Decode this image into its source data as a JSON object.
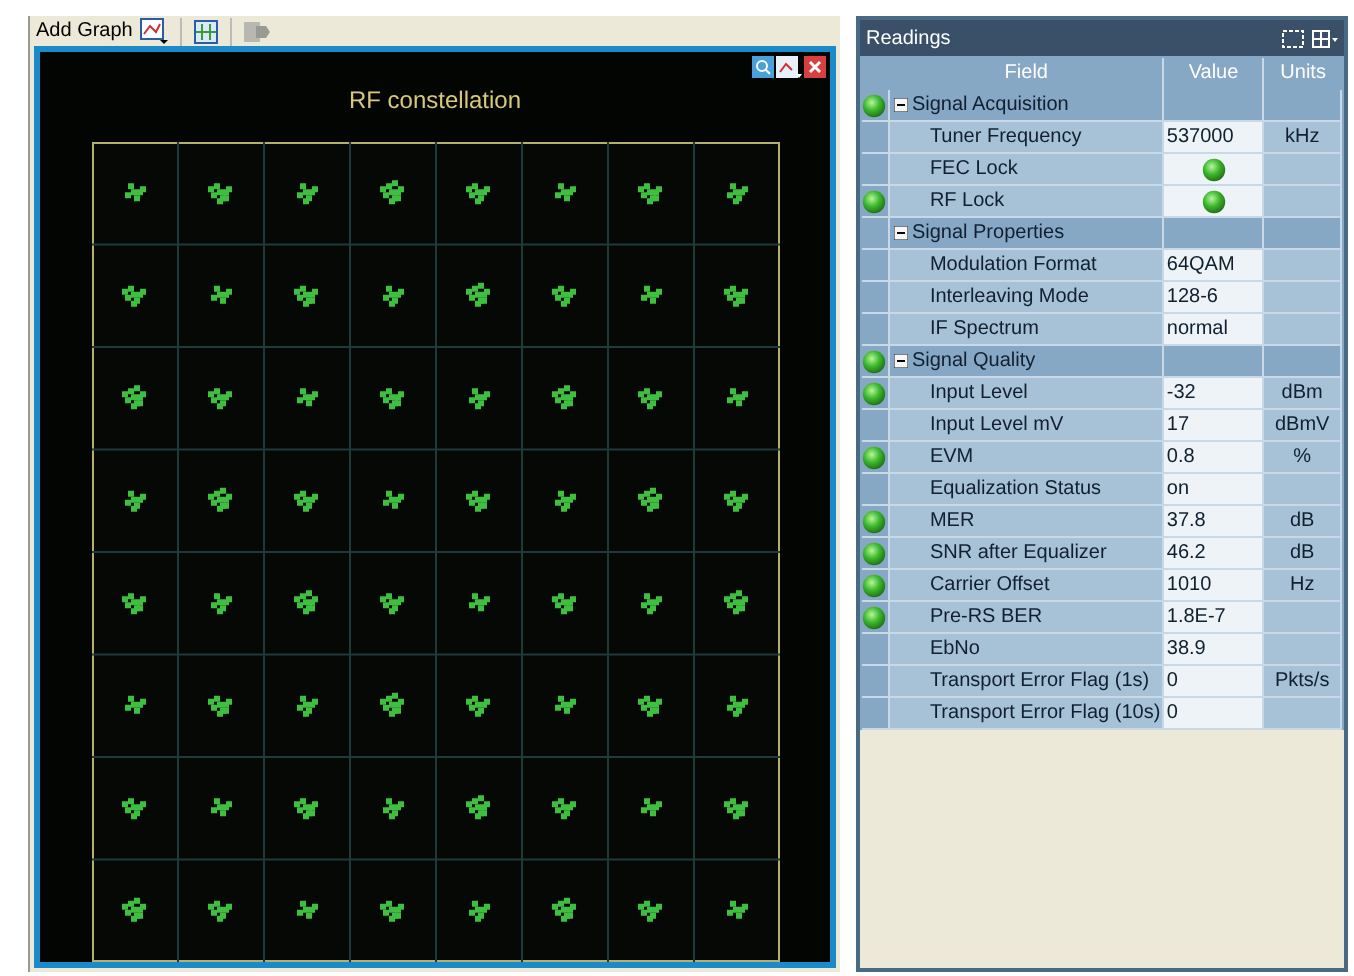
{
  "toolbar": {
    "add_graph": "Add Graph"
  },
  "graph": {
    "title": "RF constellation"
  },
  "readings": {
    "title": "Readings",
    "columns": [
      "Field",
      "Value",
      "Units"
    ],
    "rows": [
      {
        "kind": "group",
        "label": "Signal Acquisition",
        "status": true,
        "expanded": true
      },
      {
        "kind": "field",
        "label": "Tuner Frequency",
        "value": "537000",
        "units": "kHz",
        "status": false
      },
      {
        "kind": "led",
        "label": "FEC Lock",
        "status": false
      },
      {
        "kind": "led",
        "label": "RF Lock",
        "status": true
      },
      {
        "kind": "group",
        "label": "Signal Properties",
        "status": false,
        "expanded": true
      },
      {
        "kind": "field",
        "label": "Modulation Format",
        "value": "64QAM",
        "status": false
      },
      {
        "kind": "field",
        "label": "Interleaving Mode",
        "value": "128-6",
        "status": false
      },
      {
        "kind": "field",
        "label": "IF Spectrum",
        "value": "normal",
        "status": false
      },
      {
        "kind": "group",
        "label": "Signal Quality",
        "status": true,
        "expanded": true
      },
      {
        "kind": "field",
        "label": "Input Level",
        "value": "-32",
        "units": "dBm",
        "status": true
      },
      {
        "kind": "field",
        "label": "Input Level mV",
        "value": "17",
        "units": "dBmV",
        "status": false
      },
      {
        "kind": "field",
        "label": "EVM",
        "value": "0.8",
        "units": "%",
        "status": true
      },
      {
        "kind": "field",
        "label": "Equalization Status",
        "value": "on",
        "status": false
      },
      {
        "kind": "field",
        "label": "MER",
        "value": "37.8",
        "units": "dB",
        "status": true
      },
      {
        "kind": "field",
        "label": "SNR after Equalizer",
        "value": "46.2",
        "units": "dB",
        "status": true
      },
      {
        "kind": "field",
        "label": "Carrier Offset",
        "value": "1010",
        "units": "Hz",
        "status": true
      },
      {
        "kind": "field",
        "label": "Pre-RS BER",
        "value": "1.8E-7",
        "status": true
      },
      {
        "kind": "field",
        "label": "EbNo",
        "value": "38.9",
        "status": false
      },
      {
        "kind": "field",
        "label": "Transport Error Flag (1s)",
        "value": "0",
        "units": "Pkts/s",
        "status": false
      },
      {
        "kind": "field",
        "label": "Transport Error Flag (10s)",
        "value": "0",
        "status": false
      }
    ]
  }
}
